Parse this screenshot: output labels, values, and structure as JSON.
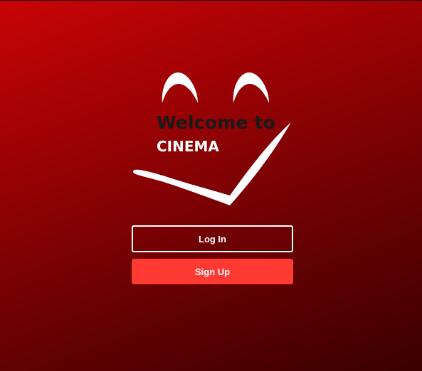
{
  "logo": {
    "welcome_text": "Welcome to",
    "brand_text": "CINEMA"
  },
  "actions": {
    "login_label": "Log In",
    "signup_label": "Sign Up"
  },
  "colors": {
    "background_start": "#c80407",
    "background_end": "#3a0000",
    "welcome_text": "#1a1a1a",
    "brand_text": "#ffffff",
    "signup_button": "#ff3a33"
  },
  "icons": {
    "left_eye": "smiling-eye-arc",
    "right_eye": "smiling-eye-arc",
    "mouth": "smile-checkmark"
  }
}
